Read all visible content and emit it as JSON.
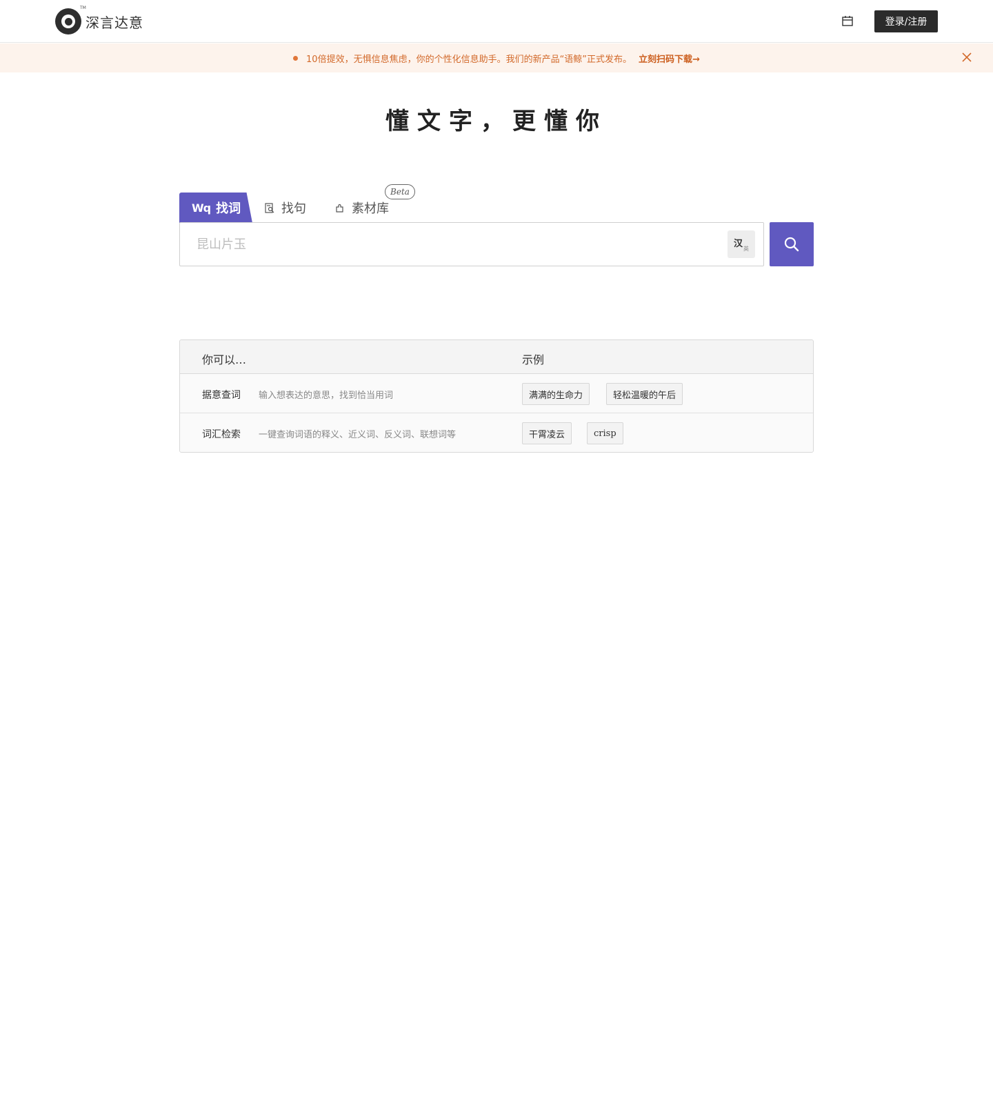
{
  "header": {
    "logo_text": "深言达意",
    "logo_tm": "TM",
    "login_label": "登录/注册"
  },
  "banner": {
    "message": "10倍提效，无惧信息焦虑，你的个性化信息助手。我们的新产品“语鲸”正式发布。",
    "link_label": "立刻扫码下载",
    "link_arrow": "→",
    "accent_color": "#d2692a"
  },
  "slogan": "懂文字，更懂你",
  "tabs": [
    {
      "icon": "Wq",
      "label": "找词",
      "active": true
    },
    {
      "icon": "document-search-icon",
      "label": "找句",
      "active": false
    },
    {
      "icon": "puzzle-icon",
      "label": "素材库",
      "active": false,
      "badge": "Beta"
    }
  ],
  "search": {
    "placeholder": "昆山片玉",
    "lang_primary": "汉",
    "lang_secondary": "英",
    "button_color": "#6059c0"
  },
  "guide": {
    "header_col1": "你可以…",
    "header_col2": "示例",
    "rows": [
      {
        "title": "据意查词",
        "desc": "输入想表达的意思，找到恰当用词",
        "examples": [
          "满满的生命力",
          "轻松温暖的午后"
        ]
      },
      {
        "title": "词汇检索",
        "desc": "一键查询词语的释义、近义词、反义词、联想词等",
        "examples": [
          "干霄凌云",
          "crisp"
        ]
      }
    ]
  }
}
